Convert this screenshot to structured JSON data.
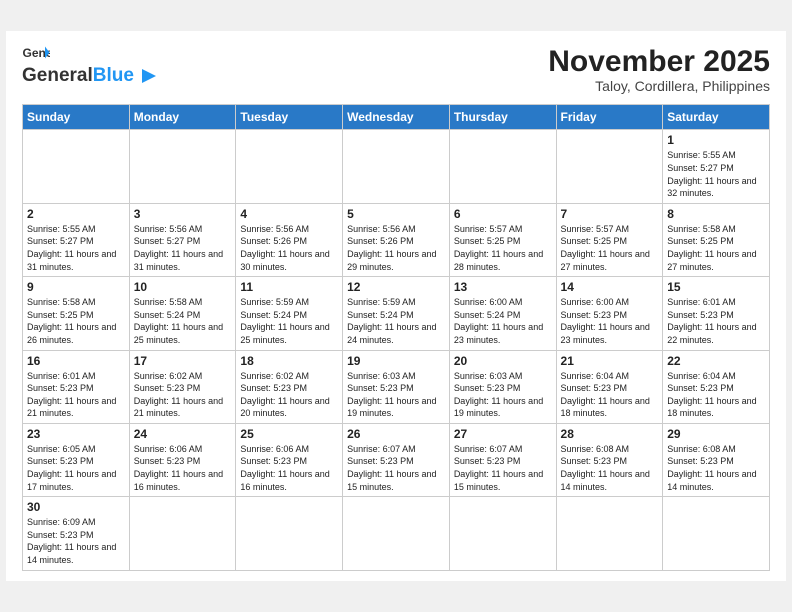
{
  "header": {
    "logo_general": "General",
    "logo_blue": "Blue",
    "month_title": "November 2025",
    "location": "Taloy, Cordillera, Philippines"
  },
  "days_of_week": [
    "Sunday",
    "Monday",
    "Tuesday",
    "Wednesday",
    "Thursday",
    "Friday",
    "Saturday"
  ],
  "weeks": [
    [
      {
        "day": "",
        "text": ""
      },
      {
        "day": "",
        "text": ""
      },
      {
        "day": "",
        "text": ""
      },
      {
        "day": "",
        "text": ""
      },
      {
        "day": "",
        "text": ""
      },
      {
        "day": "",
        "text": ""
      },
      {
        "day": "1",
        "text": "Sunrise: 5:55 AM\nSunset: 5:27 PM\nDaylight: 11 hours\nand 32 minutes."
      }
    ],
    [
      {
        "day": "2",
        "text": "Sunrise: 5:55 AM\nSunset: 5:27 PM\nDaylight: 11 hours\nand 31 minutes."
      },
      {
        "day": "3",
        "text": "Sunrise: 5:56 AM\nSunset: 5:27 PM\nDaylight: 11 hours\nand 31 minutes."
      },
      {
        "day": "4",
        "text": "Sunrise: 5:56 AM\nSunset: 5:26 PM\nDaylight: 11 hours\nand 30 minutes."
      },
      {
        "day": "5",
        "text": "Sunrise: 5:56 AM\nSunset: 5:26 PM\nDaylight: 11 hours\nand 29 minutes."
      },
      {
        "day": "6",
        "text": "Sunrise: 5:57 AM\nSunset: 5:25 PM\nDaylight: 11 hours\nand 28 minutes."
      },
      {
        "day": "7",
        "text": "Sunrise: 5:57 AM\nSunset: 5:25 PM\nDaylight: 11 hours\nand 27 minutes."
      },
      {
        "day": "8",
        "text": "Sunrise: 5:58 AM\nSunset: 5:25 PM\nDaylight: 11 hours\nand 27 minutes."
      }
    ],
    [
      {
        "day": "9",
        "text": "Sunrise: 5:58 AM\nSunset: 5:25 PM\nDaylight: 11 hours\nand 26 minutes."
      },
      {
        "day": "10",
        "text": "Sunrise: 5:58 AM\nSunset: 5:24 PM\nDaylight: 11 hours\nand 25 minutes."
      },
      {
        "day": "11",
        "text": "Sunrise: 5:59 AM\nSunset: 5:24 PM\nDaylight: 11 hours\nand 25 minutes."
      },
      {
        "day": "12",
        "text": "Sunrise: 5:59 AM\nSunset: 5:24 PM\nDaylight: 11 hours\nand 24 minutes."
      },
      {
        "day": "13",
        "text": "Sunrise: 6:00 AM\nSunset: 5:24 PM\nDaylight: 11 hours\nand 23 minutes."
      },
      {
        "day": "14",
        "text": "Sunrise: 6:00 AM\nSunset: 5:23 PM\nDaylight: 11 hours\nand 23 minutes."
      },
      {
        "day": "15",
        "text": "Sunrise: 6:01 AM\nSunset: 5:23 PM\nDaylight: 11 hours\nand 22 minutes."
      }
    ],
    [
      {
        "day": "16",
        "text": "Sunrise: 6:01 AM\nSunset: 5:23 PM\nDaylight: 11 hours\nand 21 minutes."
      },
      {
        "day": "17",
        "text": "Sunrise: 6:02 AM\nSunset: 5:23 PM\nDaylight: 11 hours\nand 21 minutes."
      },
      {
        "day": "18",
        "text": "Sunrise: 6:02 AM\nSunset: 5:23 PM\nDaylight: 11 hours\nand 20 minutes."
      },
      {
        "day": "19",
        "text": "Sunrise: 6:03 AM\nSunset: 5:23 PM\nDaylight: 11 hours\nand 19 minutes."
      },
      {
        "day": "20",
        "text": "Sunrise: 6:03 AM\nSunset: 5:23 PM\nDaylight: 11 hours\nand 19 minutes."
      },
      {
        "day": "21",
        "text": "Sunrise: 6:04 AM\nSunset: 5:23 PM\nDaylight: 11 hours\nand 18 minutes."
      },
      {
        "day": "22",
        "text": "Sunrise: 6:04 AM\nSunset: 5:23 PM\nDaylight: 11 hours\nand 18 minutes."
      }
    ],
    [
      {
        "day": "23",
        "text": "Sunrise: 6:05 AM\nSunset: 5:23 PM\nDaylight: 11 hours\nand 17 minutes."
      },
      {
        "day": "24",
        "text": "Sunrise: 6:06 AM\nSunset: 5:23 PM\nDaylight: 11 hours\nand 16 minutes."
      },
      {
        "day": "25",
        "text": "Sunrise: 6:06 AM\nSunset: 5:23 PM\nDaylight: 11 hours\nand 16 minutes."
      },
      {
        "day": "26",
        "text": "Sunrise: 6:07 AM\nSunset: 5:23 PM\nDaylight: 11 hours\nand 15 minutes."
      },
      {
        "day": "27",
        "text": "Sunrise: 6:07 AM\nSunset: 5:23 PM\nDaylight: 11 hours\nand 15 minutes."
      },
      {
        "day": "28",
        "text": "Sunrise: 6:08 AM\nSunset: 5:23 PM\nDaylight: 11 hours\nand 14 minutes."
      },
      {
        "day": "29",
        "text": "Sunrise: 6:08 AM\nSunset: 5:23 PM\nDaylight: 11 hours\nand 14 minutes."
      }
    ],
    [
      {
        "day": "30",
        "text": "Sunrise: 6:09 AM\nSunset: 5:23 PM\nDaylight: 11 hours\nand 14 minutes."
      },
      {
        "day": "",
        "text": ""
      },
      {
        "day": "",
        "text": ""
      },
      {
        "day": "",
        "text": ""
      },
      {
        "day": "",
        "text": ""
      },
      {
        "day": "",
        "text": ""
      },
      {
        "day": "",
        "text": ""
      }
    ]
  ]
}
